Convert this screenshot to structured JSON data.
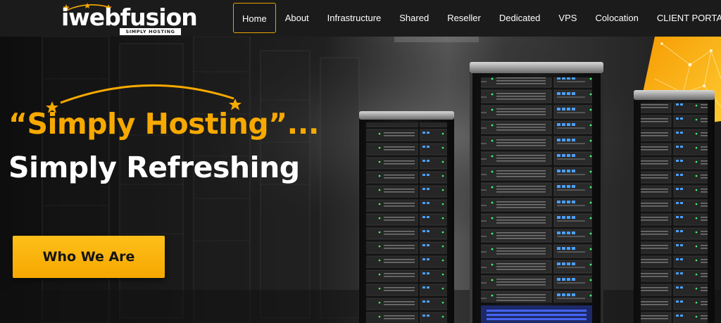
{
  "brand": {
    "name": "iwebfusion",
    "tagline": "SIMPLY HOSTING",
    "accent_color": "#f7a900"
  },
  "nav": {
    "items": [
      {
        "label": "Home",
        "active": true
      },
      {
        "label": "About"
      },
      {
        "label": "Infrastructure"
      },
      {
        "label": "Shared"
      },
      {
        "label": "Reseller"
      },
      {
        "label": "Dedicated"
      },
      {
        "label": "VPS"
      },
      {
        "label": "Colocation"
      },
      {
        "label": "CLIENT PORTAL"
      }
    ]
  },
  "hero": {
    "headline_1": "“Simply Hosting”...",
    "headline_2": "Simply Refreshing",
    "cta_label": "Who We Are",
    "decor_icons": [
      "star-icon",
      "star-icon",
      "arc-swoosh"
    ],
    "image": "server-racks"
  }
}
